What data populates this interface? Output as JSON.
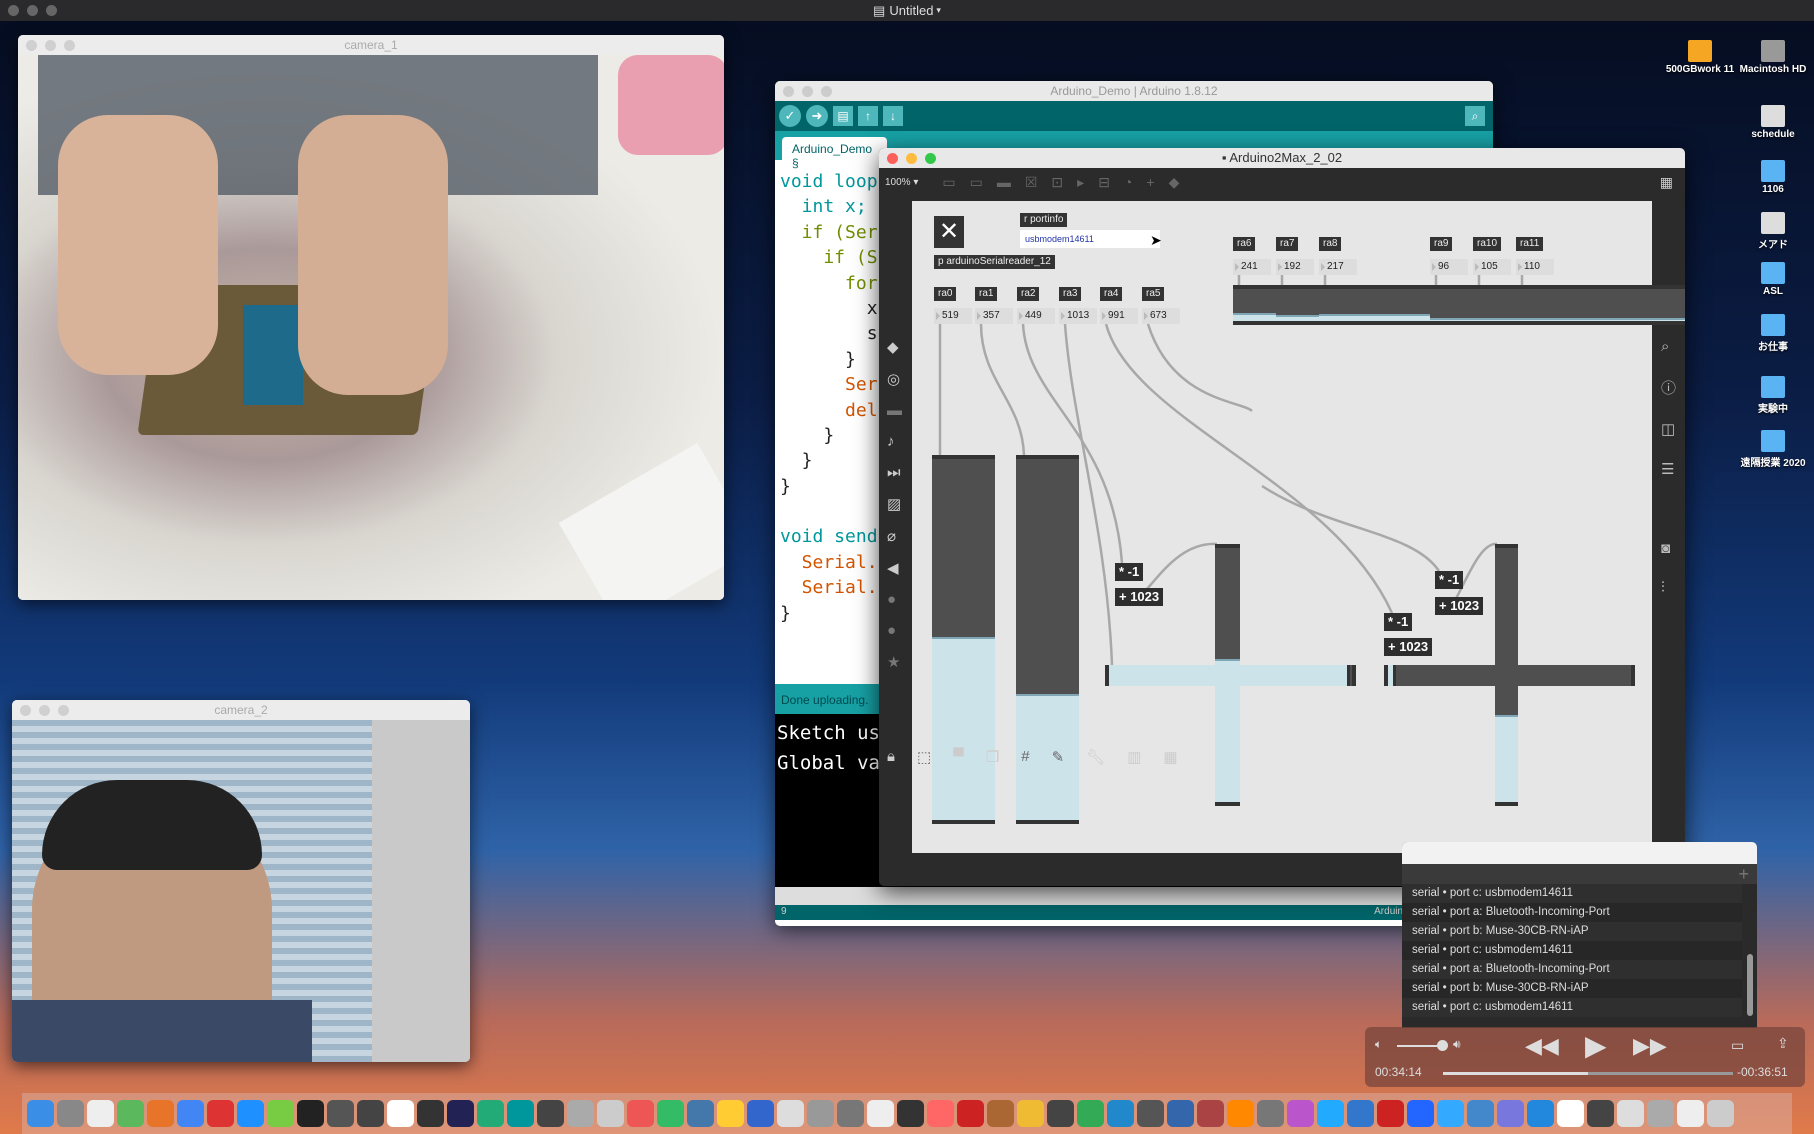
{
  "menubar": {
    "title": "Untitled"
  },
  "camera_1": {
    "title": "camera_1"
  },
  "camera_2": {
    "title": "camera_2"
  },
  "arduino": {
    "title": "Arduino_Demo | Arduino 1.8.12",
    "tab": "Arduino_Demo §",
    "code_lines": [
      "void loop",
      "  int x;",
      "  if (Ser",
      "    if (S",
      "      for",
      "        x",
      "        s",
      "      }",
      "      Ser",
      "      del",
      "    }",
      "  }",
      "}",
      "",
      "void send",
      "  Serial.",
      "  Serial.",
      "}"
    ],
    "status": "Done uploading.",
    "console_lines": [
      "Sketch us",
      "Global va"
    ],
    "footer_line": "9",
    "footer_board": "Arduino Uno on /dev/cu.u"
  },
  "max": {
    "title": "Arduino2Max_2_02",
    "zoom": "100%",
    "objects": {
      "portinfo": "r portinfo",
      "port_message": "usbmodem14611",
      "reader": "p arduinoSerialreader_12"
    },
    "receives": [
      {
        "label": "ra0",
        "value": 519
      },
      {
        "label": "ra1",
        "value": 357
      },
      {
        "label": "ra2",
        "value": 449
      },
      {
        "label": "ra3",
        "value": 1013
      },
      {
        "label": "ra4",
        "value": 991
      },
      {
        "label": "ra5",
        "value": 673
      },
      {
        "label": "ra6",
        "value": 241
      },
      {
        "label": "ra7",
        "value": 192
      },
      {
        "label": "ra8",
        "value": 217
      },
      {
        "label": "ra9",
        "value": 96
      },
      {
        "label": "ra10",
        "value": 105
      },
      {
        "label": "ra11",
        "value": 110
      }
    ],
    "slider_max": 1023,
    "ops": [
      {
        "mul": "* -1",
        "add": "+ 1023"
      },
      {
        "mul": "* -1",
        "add": "+ 1023"
      },
      {
        "mul": "* -1",
        "add": "+ 1023"
      }
    ]
  },
  "console": {
    "rows": [
      "serial • port c: usbmodem14611",
      "serial • port a: Bluetooth-Incoming-Port",
      "serial • port b: Muse-30CB-RN-iAP",
      "serial • port c: usbmodem14611",
      "serial • port a: Bluetooth-Incoming-Port",
      "serial • port b: Muse-30CB-RN-iAP",
      "serial • port c: usbmodem14611"
    ]
  },
  "video": {
    "elapsed": "00:34:14",
    "remaining": "-00:36:51",
    "progress": 0.5
  },
  "desktop_icons": [
    {
      "label": "500GBwork 11",
      "type": "drive"
    },
    {
      "label": "Macintosh HD",
      "type": "drive"
    },
    {
      "label": "schedule",
      "type": "file"
    },
    {
      "label": "1106",
      "type": "folder"
    },
    {
      "label": "メアド",
      "type": "file"
    },
    {
      "label": "ASL",
      "type": "folder"
    },
    {
      "label": "お仕事",
      "type": "folder"
    },
    {
      "label": "実験中",
      "type": "folder"
    },
    {
      "label": "遠隔授業 2020",
      "type": "folder"
    }
  ],
  "dock_colors": [
    "#3a8ee6",
    "#888",
    "#eee",
    "#5cb85c",
    "#e8742a",
    "#4285f4",
    "#d33",
    "#1e90ff",
    "#7c4",
    "#222",
    "#555",
    "#444",
    "#fff",
    "#333",
    "#225",
    "#2a7",
    "#00979c",
    "#444",
    "#aaa",
    "#ccc",
    "#e55",
    "#3b6",
    "#47a",
    "#fc3",
    "#36c",
    "#ddd",
    "#999",
    "#777",
    "#eee",
    "#333",
    "#f66",
    "#c22",
    "#a63",
    "#eb3",
    "#444",
    "#3a5",
    "#28c",
    "#555",
    "#36a",
    "#a44",
    "#f80",
    "#777",
    "#b5c",
    "#2af",
    "#37c",
    "#c22",
    "#26f",
    "#3af",
    "#48c",
    "#77d",
    "#28d",
    "#fff",
    "#444",
    "#ddd",
    "#aaa",
    "#eee",
    "#ccc"
  ]
}
